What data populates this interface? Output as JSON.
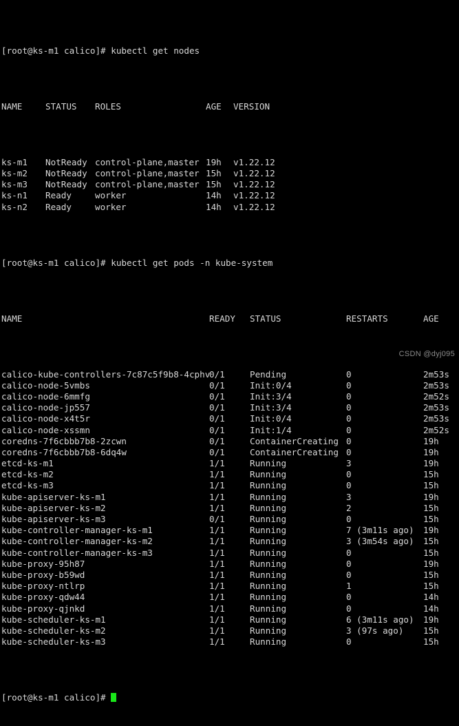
{
  "terminal": {
    "colors": {
      "background": "#000000",
      "foreground": "#d8d8d8",
      "cursor": "#19e619",
      "watermark": "#8c8c8c"
    },
    "prompt": "[root@ks-m1 calico]# ",
    "commands": {
      "get_nodes": "kubectl get nodes",
      "get_pods": "kubectl get pods -n kube-system"
    },
    "nodes_table": {
      "headers": {
        "name": "NAME",
        "status": "STATUS",
        "roles": "ROLES",
        "age": "AGE",
        "version": "VERSION"
      },
      "rows": [
        {
          "name": "ks-m1",
          "status": "NotReady",
          "roles": "control-plane,master",
          "age": "19h",
          "version": "v1.22.12"
        },
        {
          "name": "ks-m2",
          "status": "NotReady",
          "roles": "control-plane,master",
          "age": "15h",
          "version": "v1.22.12"
        },
        {
          "name": "ks-m3",
          "status": "NotReady",
          "roles": "control-plane,master",
          "age": "15h",
          "version": "v1.22.12"
        },
        {
          "name": "ks-n1",
          "status": "Ready",
          "roles": "worker",
          "age": "14h",
          "version": "v1.22.12"
        },
        {
          "name": "ks-n2",
          "status": "Ready",
          "roles": "worker",
          "age": "14h",
          "version": "v1.22.12"
        }
      ]
    },
    "pods_table": {
      "headers": {
        "name": "NAME",
        "ready": "READY",
        "status": "STATUS",
        "restarts": "RESTARTS",
        "age": "AGE"
      },
      "rows": [
        {
          "name": "calico-kube-controllers-7c87c5f9b8-4cphv",
          "ready": "0/1",
          "status": "Pending",
          "restarts": "0",
          "age": "2m53s"
        },
        {
          "name": "calico-node-5vmbs",
          "ready": "0/1",
          "status": "Init:0/4",
          "restarts": "0",
          "age": "2m53s"
        },
        {
          "name": "calico-node-6mmfg",
          "ready": "0/1",
          "status": "Init:3/4",
          "restarts": "0",
          "age": "2m52s"
        },
        {
          "name": "calico-node-jp557",
          "ready": "0/1",
          "status": "Init:3/4",
          "restarts": "0",
          "age": "2m53s"
        },
        {
          "name": "calico-node-x4t5r",
          "ready": "0/1",
          "status": "Init:0/4",
          "restarts": "0",
          "age": "2m53s"
        },
        {
          "name": "calico-node-xssmn",
          "ready": "0/1",
          "status": "Init:1/4",
          "restarts": "0",
          "age": "2m52s"
        },
        {
          "name": "coredns-7f6cbbb7b8-2zcwn",
          "ready": "0/1",
          "status": "ContainerCreating",
          "restarts": "0",
          "age": "19h"
        },
        {
          "name": "coredns-7f6cbbb7b8-6dq4w",
          "ready": "0/1",
          "status": "ContainerCreating",
          "restarts": "0",
          "age": "19h"
        },
        {
          "name": "etcd-ks-m1",
          "ready": "1/1",
          "status": "Running",
          "restarts": "3",
          "age": "19h"
        },
        {
          "name": "etcd-ks-m2",
          "ready": "1/1",
          "status": "Running",
          "restarts": "0",
          "age": "15h"
        },
        {
          "name": "etcd-ks-m3",
          "ready": "1/1",
          "status": "Running",
          "restarts": "0",
          "age": "15h"
        },
        {
          "name": "kube-apiserver-ks-m1",
          "ready": "1/1",
          "status": "Running",
          "restarts": "3",
          "age": "19h"
        },
        {
          "name": "kube-apiserver-ks-m2",
          "ready": "1/1",
          "status": "Running",
          "restarts": "2",
          "age": "15h"
        },
        {
          "name": "kube-apiserver-ks-m3",
          "ready": "0/1",
          "status": "Running",
          "restarts": "0",
          "age": "15h"
        },
        {
          "name": "kube-controller-manager-ks-m1",
          "ready": "1/1",
          "status": "Running",
          "restarts": "7 (3m11s ago)",
          "age": "19h"
        },
        {
          "name": "kube-controller-manager-ks-m2",
          "ready": "1/1",
          "status": "Running",
          "restarts": "3 (3m54s ago)",
          "age": "15h"
        },
        {
          "name": "kube-controller-manager-ks-m3",
          "ready": "1/1",
          "status": "Running",
          "restarts": "0",
          "age": "15h"
        },
        {
          "name": "kube-proxy-95h87",
          "ready": "1/1",
          "status": "Running",
          "restarts": "0",
          "age": "19h"
        },
        {
          "name": "kube-proxy-b59wd",
          "ready": "1/1",
          "status": "Running",
          "restarts": "0",
          "age": "15h"
        },
        {
          "name": "kube-proxy-ntlrp",
          "ready": "1/1",
          "status": "Running",
          "restarts": "1",
          "age": "15h"
        },
        {
          "name": "kube-proxy-qdw44",
          "ready": "1/1",
          "status": "Running",
          "restarts": "0",
          "age": "14h"
        },
        {
          "name": "kube-proxy-qjnkd",
          "ready": "1/1",
          "status": "Running",
          "restarts": "0",
          "age": "14h"
        },
        {
          "name": "kube-scheduler-ks-m1",
          "ready": "1/1",
          "status": "Running",
          "restarts": "6 (3m11s ago)",
          "age": "19h"
        },
        {
          "name": "kube-scheduler-ks-m2",
          "ready": "1/1",
          "status": "Running",
          "restarts": "3 (97s ago)",
          "age": "15h"
        },
        {
          "name": "kube-scheduler-ks-m3",
          "ready": "1/1",
          "status": "Running",
          "restarts": "0",
          "age": "15h"
        }
      ]
    },
    "watermark": "CSDN @dyj095"
  }
}
